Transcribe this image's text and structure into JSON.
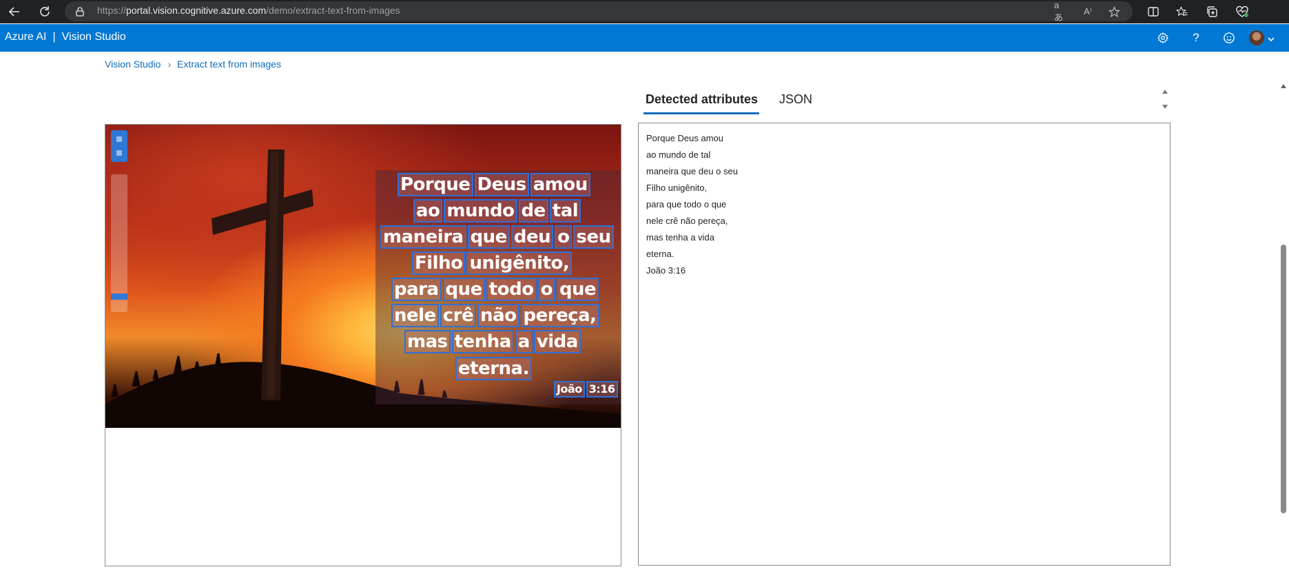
{
  "browser": {
    "url_scheme": "https://",
    "url_host": "portal.vision.cognitive.azure.com",
    "url_path": "/demo/extract-text-from-images",
    "read_aloud_label": "A⁾",
    "translate_label": "aあ"
  },
  "header": {
    "brand": "Azure AI",
    "separator": "|",
    "product": "Vision Studio",
    "help_label": "?"
  },
  "breadcrumb": {
    "root": "Vision Studio",
    "separator": "›",
    "current": "Extract text from images"
  },
  "image": {
    "ocr_lines": [
      [
        "Porque",
        "Deus",
        "amou"
      ],
      [
        "ao",
        "mundo",
        "de",
        "tal"
      ],
      [
        "maneira",
        "que",
        "deu",
        "o",
        "seu"
      ],
      [
        "Filho",
        "unigênito,"
      ],
      [
        "para",
        "que",
        "todo",
        "o",
        "que"
      ],
      [
        "nele",
        "crê",
        "não",
        "pereça,"
      ],
      [
        "mas",
        "tenha",
        "a",
        "vida"
      ],
      [
        "eterna."
      ],
      [
        "João",
        "3:16"
      ]
    ]
  },
  "results": {
    "tabs": [
      {
        "label": "Detected attributes",
        "active": true
      },
      {
        "label": "JSON",
        "active": false
      }
    ],
    "lines": [
      "Porque Deus amou",
      "ao mundo de tal",
      "maneira que deu o seu",
      "Filho unigênito,",
      "para que todo o que",
      "nele crê não pereça,",
      "mas tenha a vida",
      "eterna.",
      "João 3:16"
    ]
  },
  "colors": {
    "header_blue": "#0078d4",
    "link_blue": "#0f6cbd",
    "ocr_box": "#2f6fd8"
  }
}
